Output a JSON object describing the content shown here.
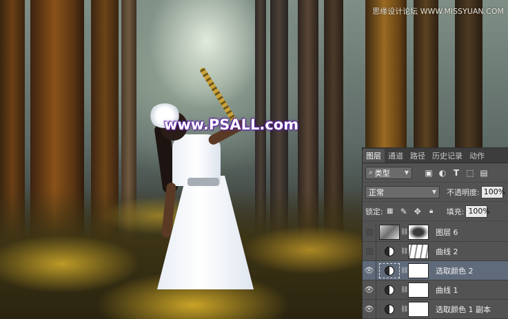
{
  "photo": {
    "site_watermark": "www.PSALL.com",
    "top_watermark": "思缘设计论坛 WWW.MISSYUAN.COM"
  },
  "panel": {
    "tabs": [
      "图层",
      "通道",
      "路径",
      "历史记录",
      "动作"
    ],
    "active_tab": "图层",
    "filter": {
      "label": "类型",
      "icon": "search-icon"
    },
    "filter_icons": [
      "image-filter-icon",
      "adjustment-filter-icon",
      "type-filter-icon",
      "shape-filter-icon",
      "smart-object-filter-icon"
    ],
    "blend_mode": "正常",
    "opacity_label": "不透明度:",
    "opacity_value": "100%",
    "lock_label": "锁定:",
    "lock_icons": [
      "lock-transparency-icon",
      "lock-brush-icon",
      "lock-move-icon",
      "lock-all-icon"
    ],
    "fill_label": "填充:",
    "fill_value": "100%",
    "layers": [
      {
        "name": "图层 6",
        "visible": false,
        "thumb": "photo",
        "mask": "soft-dark"
      },
      {
        "name": "曲线 2",
        "visible": false,
        "thumb": "adjustment",
        "mask": "textured"
      },
      {
        "name": "选取颜色 2",
        "visible": true,
        "thumb": "adjustment",
        "mask": "white",
        "selected": true
      },
      {
        "name": "曲线 1",
        "visible": true,
        "thumb": "adjustment",
        "mask": "white"
      },
      {
        "name": "选取颜色 1 副本",
        "visible": true,
        "thumb": "adjustment",
        "mask": "white"
      }
    ]
  },
  "colors": {
    "panel_bg": "#535353",
    "selected_layer": "#5f6a7a",
    "ground_gold": "#c9a23a"
  }
}
